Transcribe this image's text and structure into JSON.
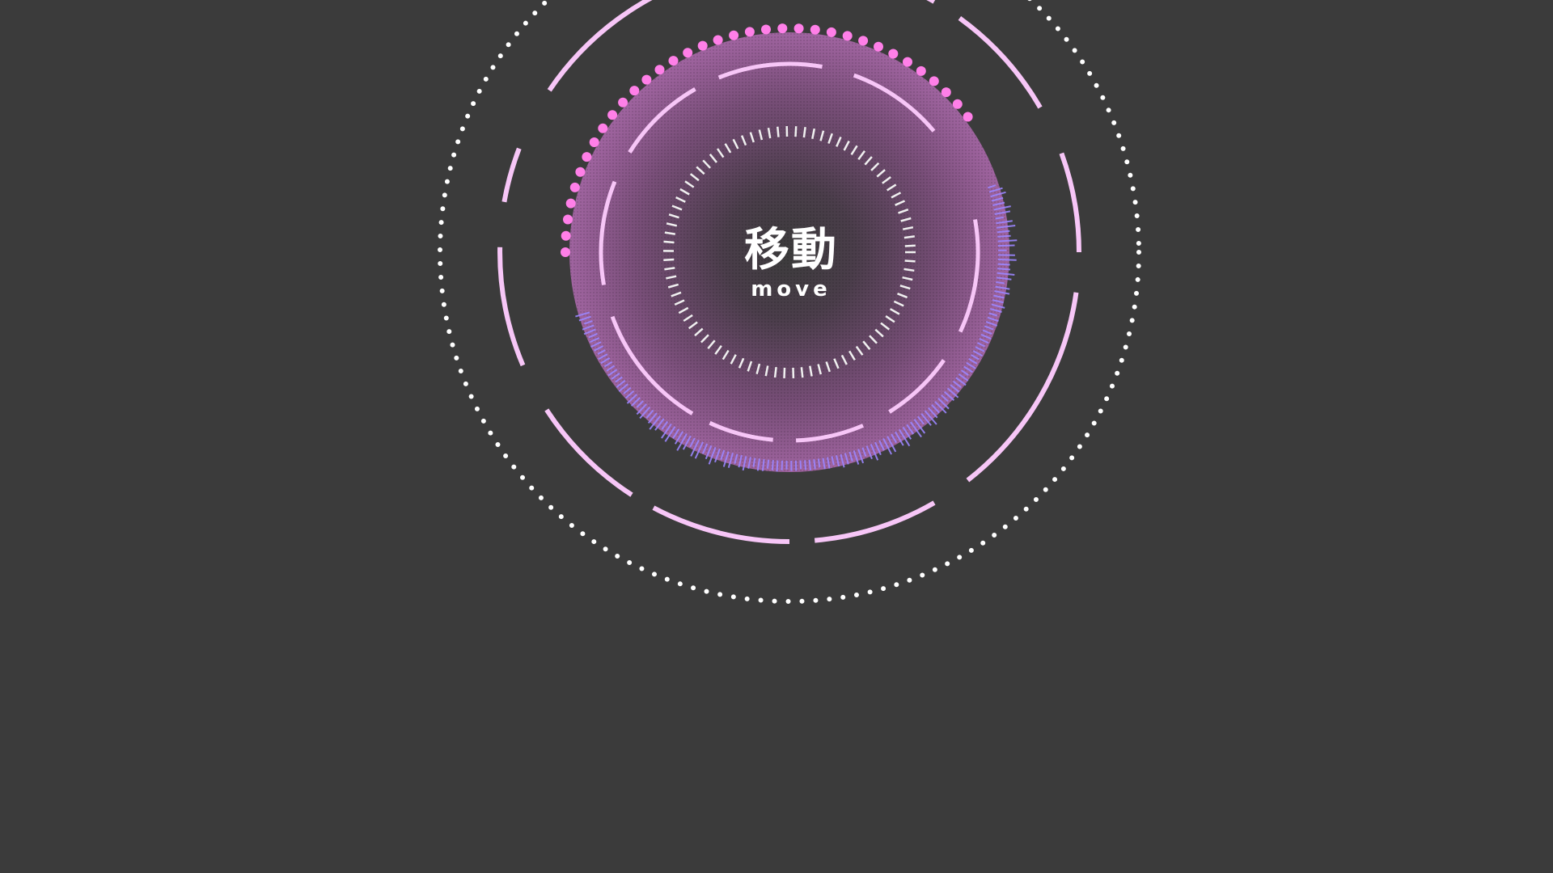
{
  "action_button": {
    "label": "移動",
    "sublabel": "move"
  },
  "colors": {
    "background": "#3b3b3b",
    "ring_pink": "#f7c6f7",
    "dots_pink": "#ff7fe8",
    "dots_white": "#ffffff",
    "disc_fill": "#a566a5",
    "spectrum_violet": "#9b86ff",
    "ticks_white": "#f0f0f0"
  }
}
